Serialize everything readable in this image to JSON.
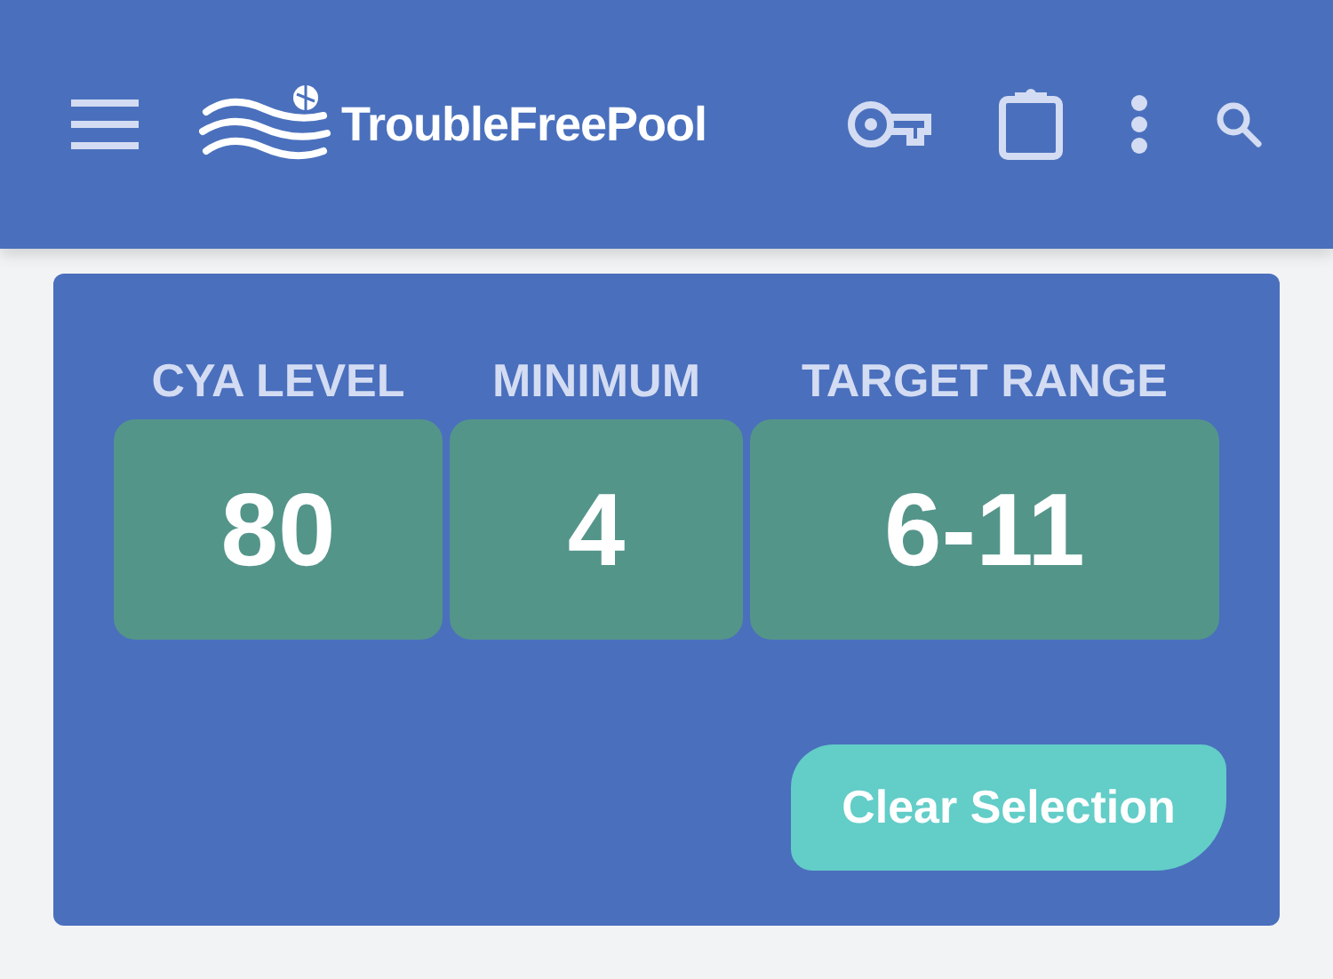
{
  "header": {
    "brand": "TroubleFreePool"
  },
  "stats": [
    {
      "label": "CYA LEVEL",
      "value": "80"
    },
    {
      "label": "MINIMUM",
      "value": "4"
    },
    {
      "label": "TARGET RANGE",
      "value": "6-11"
    }
  ],
  "button": {
    "label": "Clear Selection"
  }
}
